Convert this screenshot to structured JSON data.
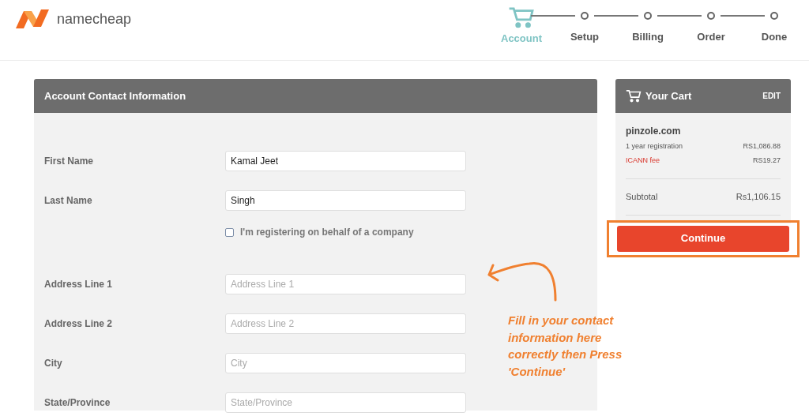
{
  "logo": {
    "text": "namecheap"
  },
  "steps": [
    {
      "label": "Account",
      "selected": true
    },
    {
      "label": "Setup",
      "selected": false
    },
    {
      "label": "Billing",
      "selected": false
    },
    {
      "label": "Order",
      "selected": false
    },
    {
      "label": "Done",
      "selected": false
    }
  ],
  "form": {
    "title": "Account Contact Information",
    "fields": [
      {
        "kind": "input",
        "label": "First Name",
        "value": "Kamal Jeet"
      },
      {
        "kind": "input",
        "label": "Last Name",
        "value": "Singh"
      },
      {
        "kind": "checkbox",
        "label": "I'm registering on behalf of a company",
        "checked": false
      },
      {
        "kind": "input",
        "label": "Address Line 1",
        "placeholder": "Address Line 1"
      },
      {
        "kind": "input",
        "label": "Address Line 2",
        "placeholder": "Address Line 2"
      },
      {
        "kind": "input",
        "label": "City",
        "placeholder": "City"
      },
      {
        "kind": "input",
        "label": "State/Province",
        "placeholder": "State/Province"
      }
    ]
  },
  "cart": {
    "title": "Your Cart",
    "edit": "EDIT",
    "domain": "pinzole.com",
    "lines": [
      {
        "kind": "normal",
        "label": "1 year registration",
        "price": "RS1,086.88"
      },
      {
        "kind": "fee",
        "label": "ICANN fee",
        "price": "RS19.27"
      }
    ],
    "subtotal_label": "Subtotal",
    "subtotal": "Rs1,106.15",
    "button": "Continue"
  },
  "annotation": {
    "text": "Fill in your contact information here correctly then Press 'Continue'"
  }
}
